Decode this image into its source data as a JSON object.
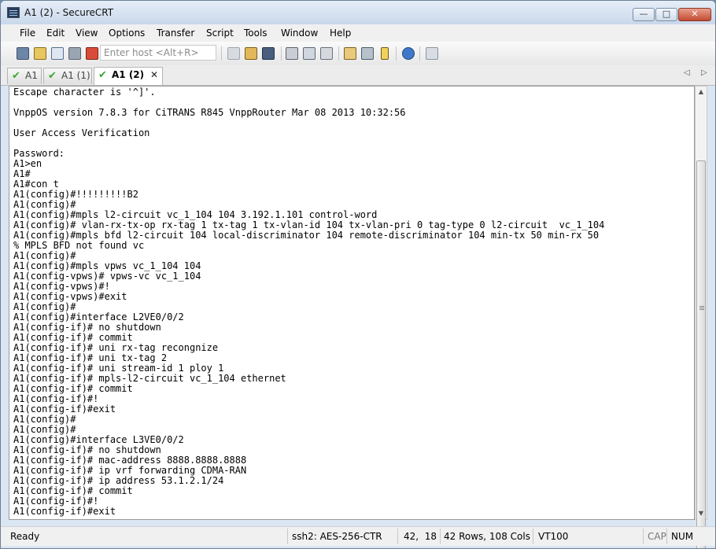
{
  "window": {
    "title": "A1 (2) - SecureCRT"
  },
  "menu": [
    "File",
    "Edit",
    "View",
    "Options",
    "Transfer",
    "Script",
    "Tools",
    "Window",
    "Help"
  ],
  "toolbar": {
    "host_placeholder": "Enter host <Alt+R>",
    "icons": [
      "connect-icon",
      "quick-connect-icon",
      "connect-in-tab-icon",
      "reconnect-icon",
      "disconnect-icon",
      "copy-icon",
      "paste-icon",
      "find-icon",
      "print-icon",
      "print-selection-icon",
      "print-screen-icon",
      "session-options-icon",
      "global-options-icon",
      "keymap-icon",
      "help-icon",
      "tile-icon"
    ]
  },
  "tabs": [
    {
      "label": "A1",
      "active": false
    },
    {
      "label": "A1 (1)",
      "active": false
    },
    {
      "label": "A1 (2)",
      "active": true
    }
  ],
  "terminal": {
    "lines": [
      "Escape character is '^]'.",
      "",
      "VnppOS version 7.8.3 for CiTRANS R845 VnppRouter Mar 08 2013 10:32:56",
      "",
      "User Access Verification",
      "",
      "Password:",
      "A1>en",
      "A1#",
      "A1#con t",
      "A1(config)#!!!!!!!!!B2",
      "A1(config)#",
      "A1(config)#mpls l2-circuit vc_1_104 104 3.192.1.101 control-word",
      "A1(config)# vlan-rx-tx-op rx-tag 1 tx-tag 1 tx-vlan-id 104 tx-vlan-pri 0 tag-type 0 l2-circuit  vc_1_104",
      "A1(config)#mpls bfd l2-circuit 104 local-discriminator 104 remote-discriminator 104 min-tx 50 min-rx 50",
      "% MPLS BFD not found vc",
      "A1(config)#",
      "A1(config)#mpls vpws vc_1_104 104",
      "A1(config-vpws)# vpws-vc vc_1_104",
      "A1(config-vpws)#!",
      "A1(config-vpws)#exit",
      "A1(config)#",
      "A1(config)#interface L2VE0/0/2",
      "A1(config-if)# no shutdown",
      "A1(config-if)# commit",
      "A1(config-if)# uni rx-tag recongnize",
      "A1(config-if)# uni tx-tag 2",
      "A1(config-if)# uni stream-id 1 ploy 1",
      "A1(config-if)# mpls-l2-circuit vc_1_104 ethernet",
      "A1(config-if)# commit",
      "A1(config-if)#!",
      "A1(config-if)#exit",
      "A1(config)#",
      "A1(config)#",
      "A1(config)#interface L3VE0/0/2",
      "A1(config-if)# no shutdown",
      "A1(config-if)# mac-address 8888.8888.8888",
      "A1(config-if)# ip vrf forwarding CDMA-RAN",
      "A1(config-if)# ip address 53.1.2.1/24",
      "A1(config-if)# commit",
      "A1(config-if)#!",
      "A1(config-if)#exit"
    ]
  },
  "status": {
    "ready": "Ready",
    "ssh": "ssh2: AES-256-CTR",
    "cursor": "42,  18",
    "size": "42 Rows, 108 Cols",
    "terminal_type": "VT100",
    "cap": "CAP",
    "num": "NUM"
  }
}
